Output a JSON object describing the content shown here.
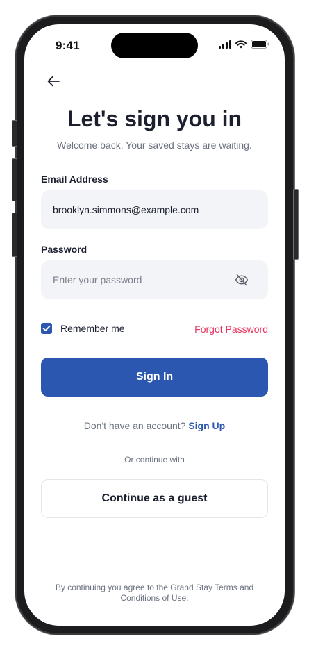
{
  "status_bar": {
    "time": "9:41"
  },
  "header": {
    "back_icon": "arrow-left-icon",
    "title": "Let's sign you in",
    "subtitle": "Welcome back. Your saved stays are waiting."
  },
  "form": {
    "email": {
      "label": "Email Address",
      "value": "brooklyn.simmons@example.com"
    },
    "password": {
      "label": "Password",
      "placeholder": "Enter your password",
      "toggle_icon": "eye-off-icon"
    },
    "remember_me": {
      "label": "Remember me",
      "checked": true
    },
    "forgot_password": "Forgot Password",
    "submit_label": "Sign In"
  },
  "signup": {
    "prompt": "Don't have an account?",
    "link": "Sign Up"
  },
  "alternate": {
    "divider_text": "Or continue with",
    "guest_label": "Continue as a guest"
  },
  "footer": {
    "text": "By continuing you agree to the Grand Stay Terms and Conditions of Use."
  },
  "colors": {
    "primary": "#2b57b0",
    "accent_link": "#e8345e",
    "field_bg": "#f3f4f7",
    "title": "#1b1f2e",
    "muted": "#6b7280"
  }
}
